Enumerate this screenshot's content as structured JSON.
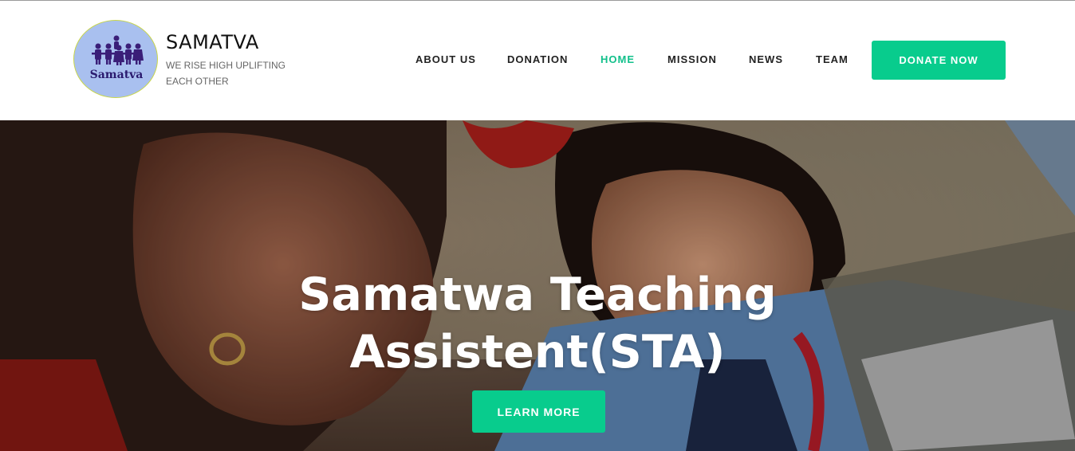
{
  "site": {
    "logo_text": "Samatva",
    "title": "SAMATVA",
    "tagline": "WE RISE HIGH UPLIFTING EACH OTHER"
  },
  "nav": {
    "items": [
      {
        "label": "ABOUT US",
        "active": false
      },
      {
        "label": "DONATION",
        "active": false
      },
      {
        "label": "HOME",
        "active": true
      },
      {
        "label": "MISSION",
        "active": false
      },
      {
        "label": "NEWS",
        "active": false
      },
      {
        "label": "TEAM",
        "active": false
      }
    ],
    "donate_label": "DONATE NOW"
  },
  "hero": {
    "title": "Samatwa Teaching Assistent(STA)",
    "button_label": "LEARN MORE"
  },
  "colors": {
    "accent": "#08cc8d",
    "nav_active": "#12c08b",
    "logo_bg": "#a9c0ef",
    "logo_ring": "#c9d64a"
  },
  "icons": {
    "logo_figures": "children-group-icon"
  }
}
